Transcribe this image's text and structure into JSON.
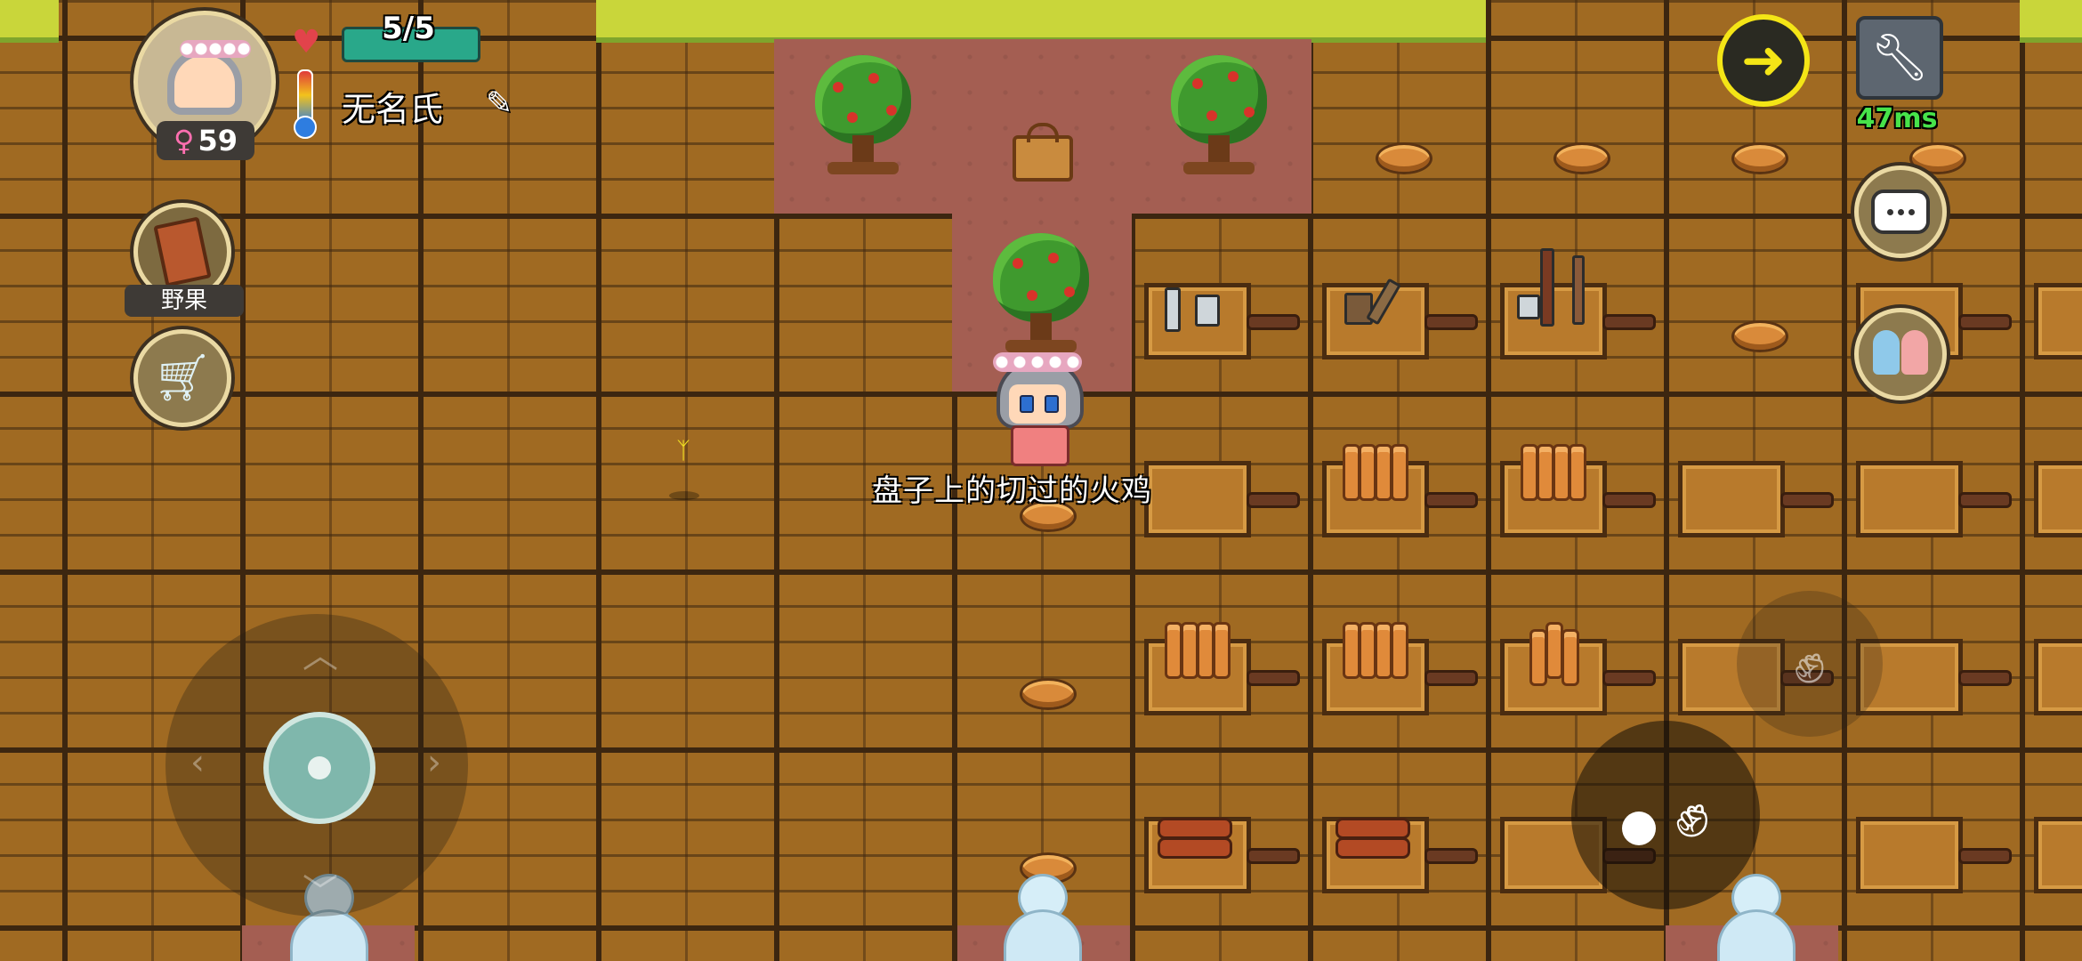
{
  "hud": {
    "food_meter": "5/5",
    "player_name": "无名氏",
    "age": "59",
    "gender_symbol": "♀",
    "craft_label": "野果",
    "ping": "47ms"
  },
  "world": {
    "hovered_item_label": "盘子上的切过的火鸡"
  },
  "icons": {
    "heart": "heart-icon",
    "thermometer": "thermometer-icon",
    "edit": "pencil-icon",
    "recipe_book": "book-icon",
    "shop": "cart-icon",
    "compass": "compass-arrow-icon",
    "settings": "wrench-icon",
    "chat": "chat-bubble-icon",
    "social": "people-icon"
  },
  "colors": {
    "food_bar": "#29a88a",
    "ping": "#47e34a",
    "compass_ring": "#f4e516",
    "gender": "#ff6fb0"
  },
  "food_level": 1.0
}
